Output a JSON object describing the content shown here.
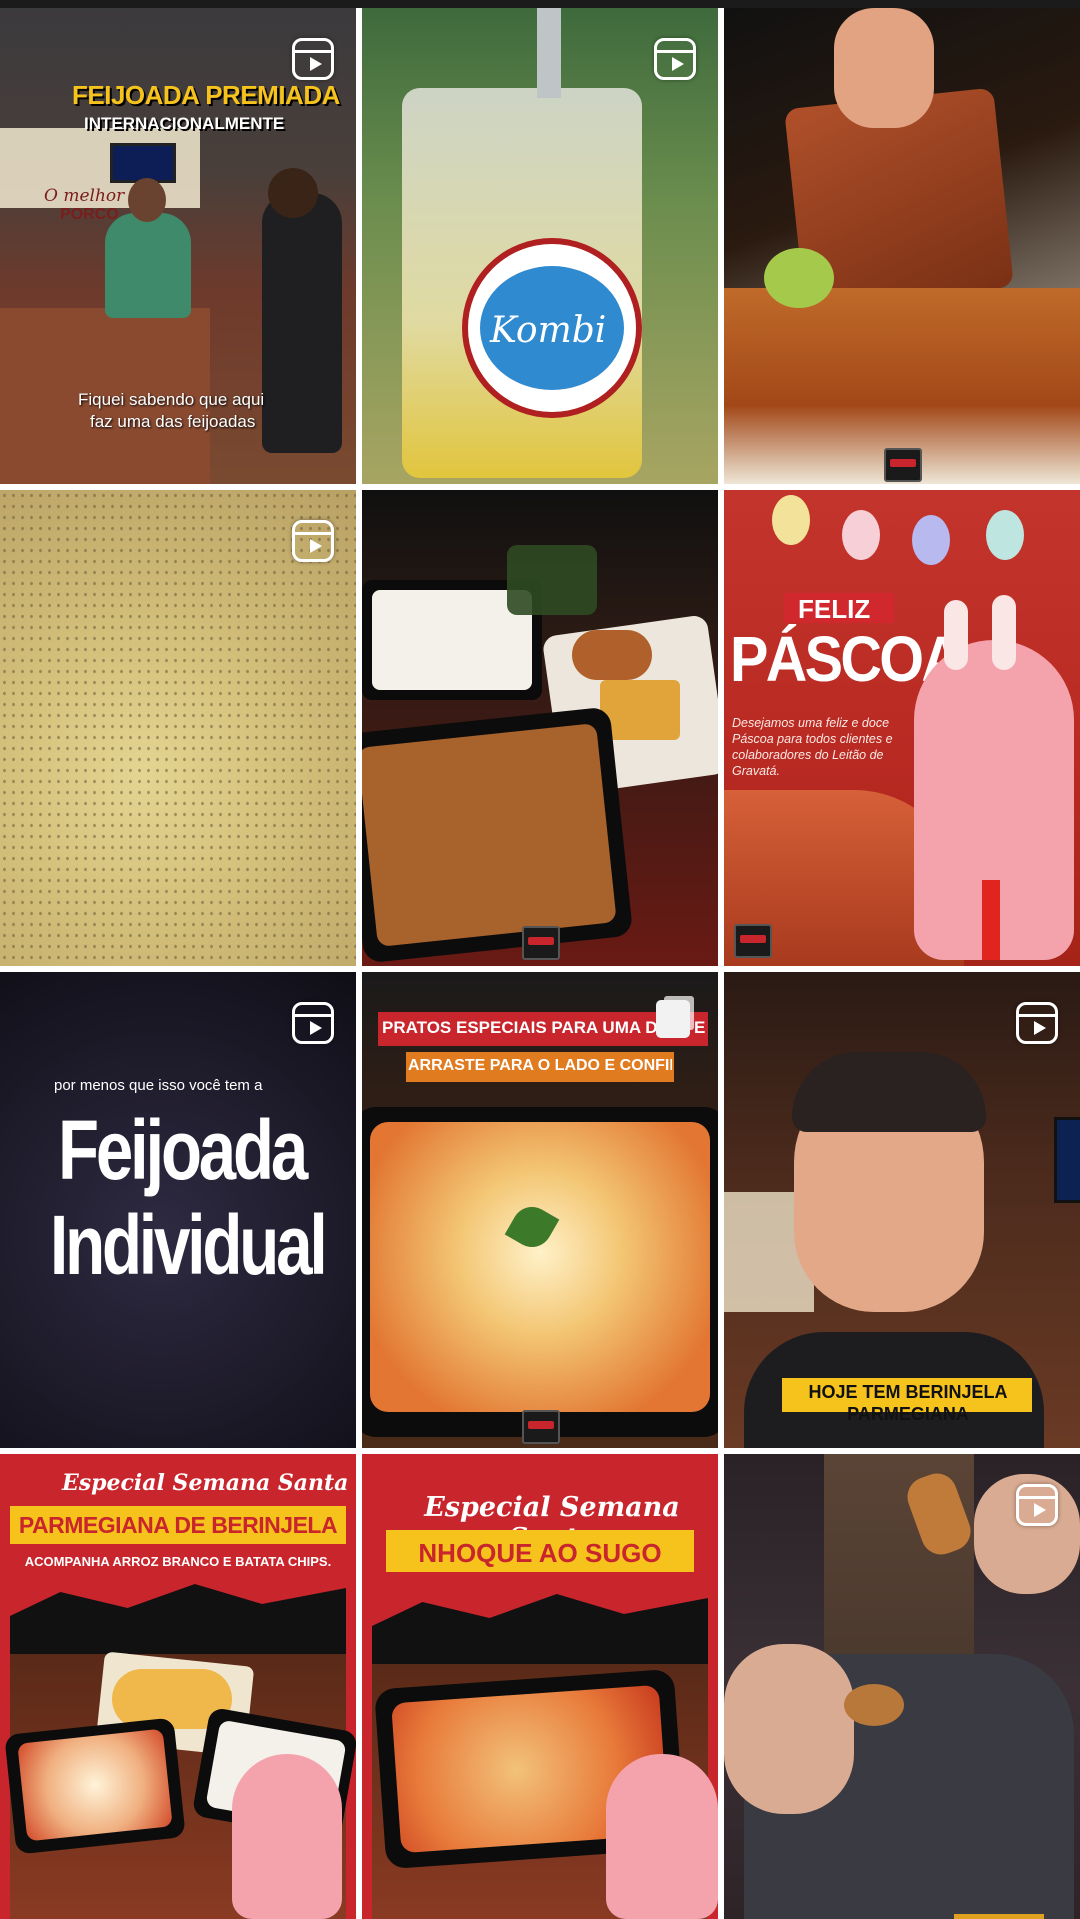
{
  "tiles": [
    {
      "id": "t1",
      "overlay_title": "FEIJOADA PREMIADA",
      "overlay_title2": "INTERNACIONALMENTE",
      "caption_line1": "Fiquei sabendo que aqui",
      "caption_line2": "faz uma das feijoadas",
      "wall_text1": "O melhor",
      "wall_text2": "PORCO",
      "type": "reel"
    },
    {
      "id": "t2",
      "mug_logo": "Kombi",
      "type": "reel"
    },
    {
      "id": "t3",
      "type": "post"
    },
    {
      "id": "t4",
      "type": "reel"
    },
    {
      "id": "t5",
      "type": "post"
    },
    {
      "id": "t6",
      "title_small": "FELIZ",
      "title_big": "PÁSCOA",
      "body": "Desejamos uma feliz e doce Páscoa para todos clientes e colaboradores do Leitão de Gravatá.",
      "type": "post"
    },
    {
      "id": "t7",
      "line1": "por menos que isso você tem a",
      "line2": "Feijoada",
      "line3": "Individual",
      "type": "reel"
    },
    {
      "id": "t8",
      "banner1": "PRATOS ESPECIAIS PARA UMA DATA ESPECIAL",
      "banner2": "ARRASTE PARA O LADO E CONFIRA!!",
      "type": "carousel"
    },
    {
      "id": "t9",
      "caption_line1": "HOJE TEM BERINJELA",
      "caption_line2": "PARMEGIANA",
      "type": "reel"
    },
    {
      "id": "t10",
      "script_title": "Especial Semana Santa",
      "title": "PARMEGIANA DE BERINJELA",
      "subtitle": "ACOMPANHA ARROZ BRANCO E BATATA CHIPS.",
      "type": "post"
    },
    {
      "id": "t11",
      "script_title": "Especial Semana Santa",
      "title": "NHOQUE AO SUGO",
      "type": "post"
    },
    {
      "id": "t12",
      "type": "reel"
    }
  ],
  "colors": {
    "brand_red": "#c9252c",
    "gold": "#f6c21c",
    "dark": "#1b1b1b"
  }
}
